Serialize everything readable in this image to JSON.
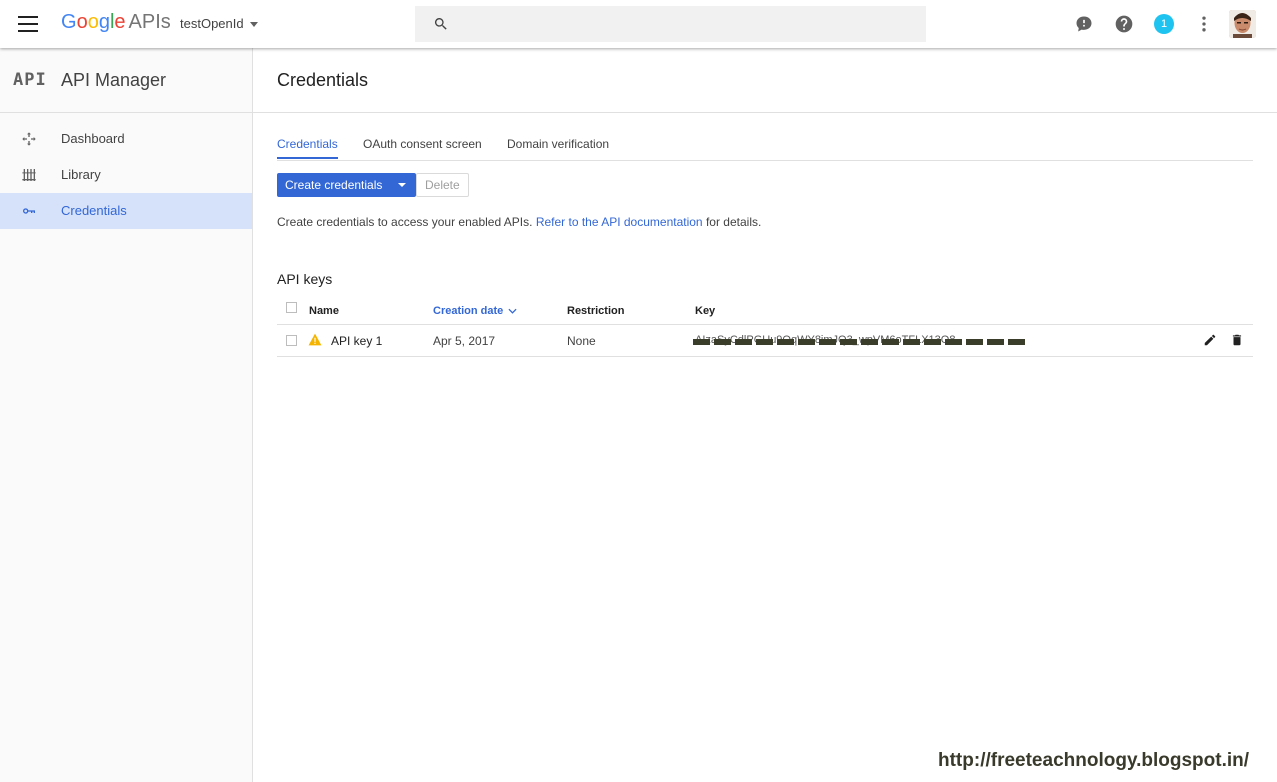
{
  "topbar": {
    "logo_google": [
      "G",
      "o",
      "o",
      "g",
      "l",
      "e"
    ],
    "logo_apis": "APIs",
    "project_name": "testOpenId",
    "notification_count": "1"
  },
  "sidebar": {
    "badge": "API",
    "title": "API Manager",
    "items": [
      {
        "label": "Dashboard",
        "icon": "dashboard-icon"
      },
      {
        "label": "Library",
        "icon": "library-icon"
      },
      {
        "label": "Credentials",
        "icon": "key-icon",
        "active": true
      }
    ]
  },
  "main": {
    "page_title": "Credentials",
    "tabs": [
      {
        "label": "Credentials",
        "active": true
      },
      {
        "label": "OAuth consent screen"
      },
      {
        "label": "Domain verification"
      }
    ],
    "create_button": "Create credentials",
    "delete_button": "Delete",
    "description_prefix": "Create credentials to access your enabled APIs.",
    "description_link": "Refer to the API documentation",
    "description_suffix": "for details.",
    "section_title": "API keys",
    "table": {
      "headers": {
        "name": "Name",
        "date": "Creation date",
        "restriction": "Restriction",
        "key": "Key"
      },
      "rows": [
        {
          "name": "API key 1",
          "date": "Apr 5, 2017",
          "restriction": "None",
          "key": "AIzaSyCdlPGUu9OqWY8imJQ3_wpVM6oTFLX13O8"
        }
      ]
    }
  },
  "watermark": "http://freeteachnology.blogspot.in/",
  "colors": {
    "accent": "#3367d6",
    "active_nav_bg": "#d5e2f9",
    "warning": "#f4b400",
    "badge": "#1fc3f0"
  }
}
